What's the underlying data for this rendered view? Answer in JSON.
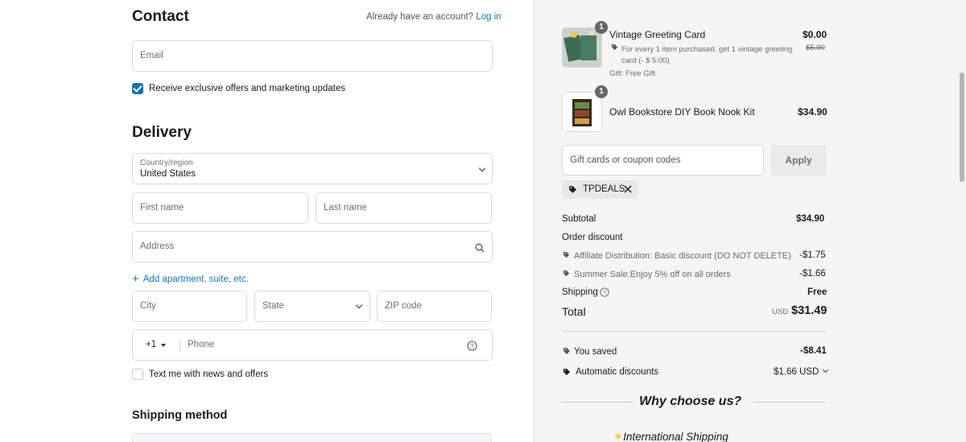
{
  "contact": {
    "title": "Contact",
    "have_account": "Already have an account?",
    "login_link": "Log in",
    "email_placeholder": "Email",
    "marketing_label": "Receive exclusive offers and marketing updates"
  },
  "delivery": {
    "title": "Delivery",
    "country_label": "Country/region",
    "country_value": "United States",
    "first_name_placeholder": "First name",
    "last_name_placeholder": "Last name",
    "address_placeholder": "Address",
    "add_apartment": "Add apartment, suite, etc.",
    "city_placeholder": "City",
    "state_placeholder": "State",
    "zip_placeholder": "ZIP code",
    "phone_code": "+1",
    "phone_placeholder": "Phone",
    "text_me_label": "Text me with news and offers"
  },
  "shipping_method": {
    "title": "Shipping method"
  },
  "summary": {
    "items": [
      {
        "qty": "1",
        "name": "Vintage Greeting Card",
        "price": "$0.00",
        "original_price": "$5.00",
        "promo": "For every 1 item purchased, get 1 vintage greeting card (- $ 5.00)",
        "promo_line1": "For every 1 item purchased, get 1 vintage greeting",
        "promo_line2": "card (- $ 5.00)",
        "gift": "Gift: Free Gift"
      },
      {
        "qty": "1",
        "name": "Owl Bookstore DIY Book Nook Kit",
        "price": "$34.90"
      }
    ],
    "coupon_placeholder": "Gift cards or coupon codes",
    "apply_label": "Apply",
    "applied_code": "TPDEALS",
    "subtotal_label": "Subtotal",
    "subtotal_value": "$34.90",
    "order_discount_label": "Order discount",
    "discounts": [
      {
        "label": "Affiliate Distribution: Basic discount (DO NOT DELETE)",
        "value": "-$1.75"
      },
      {
        "label": "Summer Sale:Enjoy 5% off on all orders",
        "value": "-$1.66"
      }
    ],
    "shipping_label": "Shipping",
    "shipping_value": "Free",
    "total_label": "Total",
    "currency": "USD",
    "total_value": "$31.49",
    "you_saved_label": "You saved",
    "you_saved_value": "-$8.41",
    "auto_discounts_label": "Automatic discounts",
    "auto_discounts_value": "$1.66 USD",
    "why_title": "Why choose us?",
    "intl_shipping": "International Shipping"
  },
  "colors": {
    "link": "#1773b0",
    "panel_bg": "#f5f5f5"
  }
}
